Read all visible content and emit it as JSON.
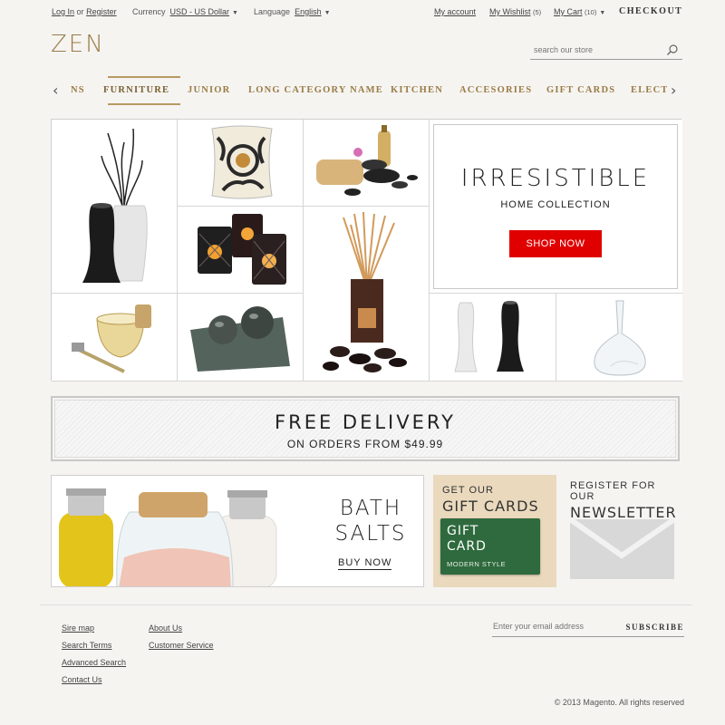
{
  "topbar": {
    "login": "Log In",
    "or": "or",
    "register": "Register",
    "currency_label": "Currency",
    "currency_value": "USD - US Dollar",
    "language_label": "Language",
    "language_value": "English",
    "my_account": "My account",
    "wishlist": "My Wishlist",
    "wishlist_count": "(5)",
    "cart": "My Cart",
    "cart_count": "(10)",
    "checkout": "CHECKOUT"
  },
  "header": {
    "logo": "ZEN",
    "search_placeholder": "search our store",
    "brand_color": "#9a7b45"
  },
  "nav": {
    "items": [
      "NS",
      "FURNITURE",
      "JUNIOR",
      "LONG CATEGORY NAME",
      "KITCHEN",
      "ACCESORIES",
      "GIFT CARDS",
      "ELECT"
    ],
    "active": "FURNITURE"
  },
  "grid": {
    "products": [
      "vase-with-branches",
      "floral-pillow",
      "spa-stones-set",
      "candle-holders",
      "reed-diffuser",
      "shaving-set",
      "stone-spheres-tray",
      "white-black-vases",
      "glass-decanter"
    ]
  },
  "promo": {
    "title": "IRRESISTIBLE",
    "subtitle": "HOME COLLECTION",
    "button": "SHOP NOW",
    "button_color": "#e00000"
  },
  "delivery": {
    "title": "FREE DELIVERY",
    "subtitle": "ON ORDERS FROM $49.99"
  },
  "bath": {
    "line1": "BATH",
    "line2": "SALTS",
    "button": "BUY NOW"
  },
  "gift": {
    "line1": "GET OUR",
    "line2": "GIFT CARDS",
    "card_line1": "GIFT",
    "card_line2": "CARD",
    "card_sub": "MODERN STYLE"
  },
  "newsletter": {
    "line1": "REGISTER FOR OUR",
    "line2": "NEWSLETTER"
  },
  "footer": {
    "col1": [
      "Sire map",
      "Search Terms",
      "Advanced Search",
      "Contact Us"
    ],
    "col2": [
      "About Us",
      "Customer Service"
    ],
    "email_placeholder": "Enter your email address",
    "subscribe": "SUBSCRIBE",
    "copyright": "© 2013 Magento. All rights reserved"
  }
}
